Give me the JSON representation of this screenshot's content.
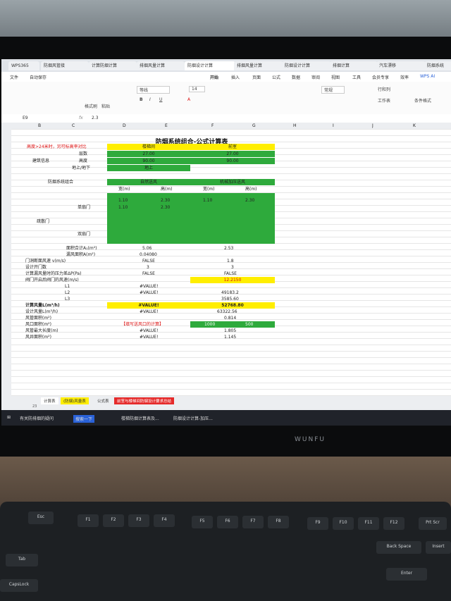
{
  "browser_tabs": [
    "WPS365",
    "防烟风管接",
    "计算防烟计算",
    "排烟风量计算",
    "防烟设计计算",
    "排烟风量计算",
    "防烟设计计算",
    "排烟计算",
    "汽车漂移",
    "防烟系统"
  ],
  "menu": [
    "文件",
    "自动保存",
    "开始",
    "插入",
    "页面",
    "公式",
    "数据",
    "审阅",
    "视图",
    "工具",
    "会员专享",
    "效率",
    "WPS AI"
  ],
  "ribbon": {
    "format": "格式刷",
    "paste": "粘贴",
    "font": "等线",
    "size": "14",
    "numfmt": "常规",
    "rows": "行和列",
    "worksheet": "工作表",
    "condfmt": "条件格式"
  },
  "formula_bar": {
    "cell": "E9",
    "fx": "fx",
    "value": "2.3"
  },
  "columns": [
    "A",
    "B",
    "C",
    "D",
    "E",
    "F",
    "G",
    "H",
    "I",
    "J",
    "K",
    "L",
    "M"
  ],
  "sheet": {
    "title": "防烟系统组合-公式计算表",
    "note": "高度>24米时，另可标高率对比",
    "hdr_left": "楼梯间",
    "hdr_right": "前室",
    "building_info": "建筑信息",
    "floors_label": "层数",
    "height_label": "高度",
    "above_label": "地上/地下",
    "floors_left": "27.00",
    "floors_right": "27.00",
    "height_left": "90.00",
    "height_right": "90.00",
    "above_left": "地上",
    "combo_label": "防烟系统组合",
    "combo_left": "自然送风",
    "combo_right": "机械加压送风",
    "width_label": "宽(m)",
    "high_label": "高(m)",
    "door_label": "疏散门",
    "single_door": "单扇门",
    "double_door": "双扇门",
    "d1_w": "1.10",
    "d1_h": "2.30",
    "d1_w2": "1.10",
    "d1_h2": "2.30",
    "d2_w": "1.10",
    "d2_h": "2.30",
    "area_label": "面积合计A₁(m²)",
    "area_left": "5.06",
    "area_right": "2.53",
    "leak_label": "漏风面积A(m²)",
    "leak_left": "0.04080",
    "v_label": "门洞断面风速 v(m/s)",
    "v_left": "FALSE",
    "v_right": "1.8",
    "n_label": "设计开门数",
    "n_left": "3",
    "n_right": "3",
    "p_label": "计算漏风量时的压力差ΔP(Pa)",
    "p_left": "FALSE",
    "p_right": "FALSE",
    "vel_label": "阀门开启后阀门的风速(m/s)",
    "vel_right": "12.2150",
    "l1": "L1",
    "l2": "L2",
    "l3": "L3",
    "l1_left": "#VALUE!",
    "l2_left": "#VALUE!",
    "l2_right": "49183.2",
    "l3_right": "3585.60",
    "calc_label": "计算风量L(m³/h)",
    "calc_left": "#VALUE!",
    "calc_right": "52768.80",
    "design_label": "设计风量L(m³/h)",
    "design_left": "#VALUE!",
    "design_right": "63322.56",
    "duct_label": "风管面积(m²)",
    "duct_right": "0.814",
    "outlet_label": "风口面积(m²)",
    "outlet_note": "【填写送风口的计算】",
    "outlet_r1": "1000",
    "outlet_r2": "500",
    "len_label": "风管最大长度(m)",
    "len_left": "#VALUE!",
    "len_right": "1.805",
    "shaft_label": "风井面积(m²)",
    "shaft_left": "#VALUE!",
    "shaft_right": "1.145"
  },
  "sheet_tabs": [
    "计算表",
    "(防烟)风量表",
    "公式表",
    "前室与楼梯间防烟设计要求总结"
  ],
  "status_cell": "23",
  "taskbar": [
    "有关防排烟的疑问",
    "搜索一下",
    "楼梯防烟计算表及...",
    "防烟设计计算-加压..."
  ],
  "monitor_brand": "WUNFU",
  "keys": [
    "Esc",
    "F1",
    "F2",
    "F3",
    "F4",
    "F5",
    "F6",
    "F7",
    "F8",
    "F9",
    "F10",
    "F11",
    "F12",
    "Prt Scr",
    "Back Space",
    "Tab",
    "Enter",
    "CapsLock",
    "Insert"
  ]
}
